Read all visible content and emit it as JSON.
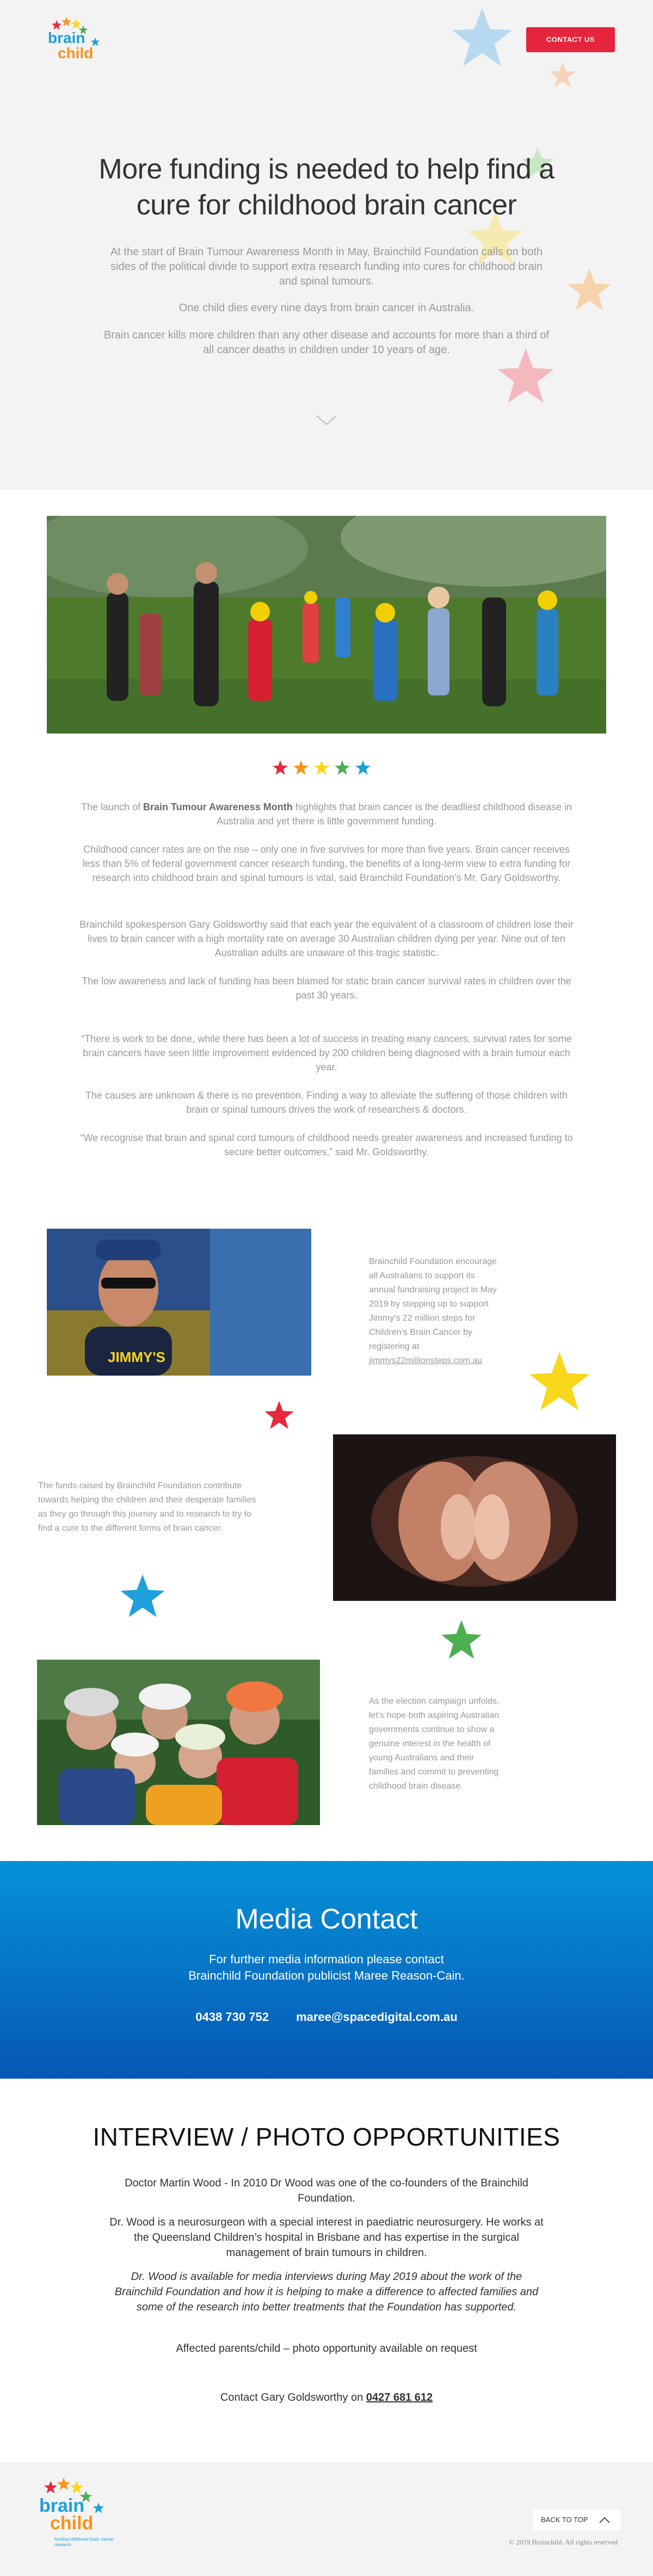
{
  "header": {
    "logo_word1": "brain",
    "logo_word2": "child",
    "cta_label": "CONTACT US"
  },
  "hero": {
    "title": "More funding is needed to help find a cure for childhood brain cancer",
    "p1": "At the start of Brain Tumour Awareness Month in May, Brainchild Foundation calls on both sides of the political divide to support extra research funding into cures for childhood brain and spinal tumours.",
    "p2": "One child dies every nine days from brain cancer in Australia.",
    "p3": "Brain cancer kills more children than any other disease and accounts for more than a third of all cancer deaths in children under 10 years of age."
  },
  "article": {
    "p1_pre": "The launch of ",
    "p1_bold": "Brain Tumour Awareness Month",
    "p1_post": " highlights that brain cancer is the deadliest childhood disease in Australia and yet there is little government funding.",
    "p2": "Childhood cancer rates are on the rise – only one in five survives for more than five years. Brain cancer receives less than 5% of federal government cancer research funding, the benefits of a long-term view to extra funding for research into childhood brain and spinal tumours is vital, said Brainchild Foundation’s Mr. Gary Goldsworthy.",
    "p3": "Brainchild spokesperson Gary Goldsworthy said that each year the equivalent of a classroom of children lose their lives to brain cancer with a high mortality rate on average 30 Australian children dying per year. Nine out of ten Australian adults are unaware of this tragic statistic.",
    "p4": "The low awareness and lack of funding has been blamed for static brain cancer survival rates in children over the past 30 years.",
    "p5": "“There is work to be done, while there has been a lot of success in treating many cancers, survival rates for some brain cancers have seen little improvement evidenced by 200 children being diagnosed with a brain tumour each year.",
    "p6": "The causes are unknown & there is no prevention. Finding a way to alleviate the suffering of those children with brain or spinal tumours drives the work of researchers & doctors.",
    "p7": "“We recognise that brain and spinal cord tumours of childhood needs greater awareness and increased funding to secure better outcomes,” said Mr. Goldsworthy."
  },
  "features": {
    "f1_text": "Brainchild Foundation encourage all Australians to support its annual fundraising project in May 2019 by stepping up to support Jimmy’s 22 million steps for Children’s Brain Cancer by registering at",
    "f1_link": "jimmys22millionsteps.com.au",
    "f2_text": "The funds raised by Brainchild Foundation contribute towards helping the children and their desperate families as they go through this journey and to research to try to find a cure to the different forms of brain cancer.",
    "f3_text": "As the election campaign unfolds, let’s hope both aspiring Australian governments continue to show a genuine interest in the health of young Australians and their families and commit to preventing childhood brain disease.",
    "shirt_text": "JIMMY'S"
  },
  "media": {
    "title": "Media Contact",
    "line1": "For further media information please contact",
    "line2": "Brainchild Foundation publicist Maree Reason-Cain.",
    "phone": "0438 730 752",
    "email": "maree@spacedigital.com.au"
  },
  "interview": {
    "title": "INTERVIEW / PHOTO OPPORTUNITIES",
    "p1": "Doctor Martin Wood - In 2010 Dr Wood was one of the co-founders of the Brainchild Foundation.",
    "p2": "Dr. Wood is a neurosurgeon with a special interest in paediatric neurosurgery.  He works at the Queensland Children’s hospital in Brisbane and has expertise in the surgical management of brain tumours in children.",
    "p3": "Dr. Wood is available for media interviews during May 2019 about the work of the Brainchild Foundation and how it is helping to make a difference to affected families and some of the research into better treatments that the Foundation has supported.",
    "p4": "Affected parents/child – photo opportunity available on request",
    "contact_pre": "Contact Gary Goldsworthy on ",
    "contact_phone": "0427 681 612"
  },
  "footer": {
    "logo_word1": "brain",
    "logo_word2": "child",
    "tagline": "funding childhood brain cancer research",
    "back_to_top": "BACK TO TOP",
    "copyright": "© 2019 Brainchild. All rights reserved"
  },
  "colors": {
    "accent_red": "#e5243d",
    "media_blue": "#0592d8",
    "star_red": "#e8283c",
    "star_orange": "#f7941d",
    "star_yellow": "#f9d71c",
    "star_green": "#4caf50",
    "star_blue": "#1ea0dc"
  }
}
